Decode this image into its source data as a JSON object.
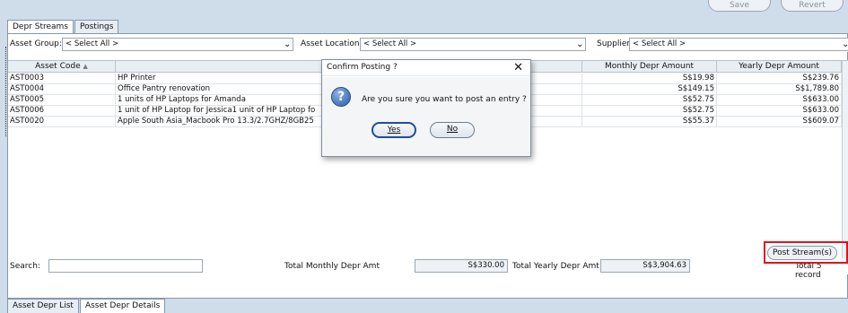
{
  "toolbar": {
    "save_label": "Save",
    "revert_label": "Revert"
  },
  "top_tabs": [
    "Depr Streams",
    "Postings"
  ],
  "filters": {
    "asset_group_label": "Asset Group:",
    "asset_group_value": "< Select All >",
    "asset_location_label": "Asset Location:",
    "asset_location_value": "< Select All >",
    "supplier_label": "Supplier:",
    "supplier_value": "< Select All >"
  },
  "grid": {
    "headers": [
      "Asset Code",
      "",
      "Monthly Depr Amount",
      "Yearly Depr Amount"
    ],
    "rows": [
      [
        "AST0003",
        "HP Printer",
        "S$19.98",
        "S$239.76"
      ],
      [
        "AST0004",
        "Office Pantry renovation",
        "S$149.15",
        "S$1,789.80"
      ],
      [
        "AST0005",
        "1 units of HP Laptops for Amanda",
        "S$52.75",
        "S$633.00"
      ],
      [
        "AST0006",
        "1 unit of HP Laptop for Jessica1 unit of HP Laptop fo",
        "S$52.75",
        "S$633.00"
      ],
      [
        "AST0020",
        "Apple South Asia_Macbook Pro 13.3/2.7GHZ/8GB25",
        "S$55.37",
        "S$609.07"
      ]
    ]
  },
  "footer": {
    "search_label": "Search:",
    "total_monthly_label": "Total Monthly Depr Amt",
    "total_monthly_value": "S$330.00",
    "total_yearly_label": "Total Yearly Depr Amt",
    "total_yearly_value": "S$3,904.63",
    "total_records": "Total 5 record",
    "post_button": "Post Stream(s)"
  },
  "bottom_tabs": [
    "Asset Depr List",
    "Asset Depr Details"
  ],
  "dialog": {
    "title": "Confirm Posting ?",
    "message": "Are you sure you want to post an entry ?",
    "yes": "Yes",
    "no": "No"
  }
}
